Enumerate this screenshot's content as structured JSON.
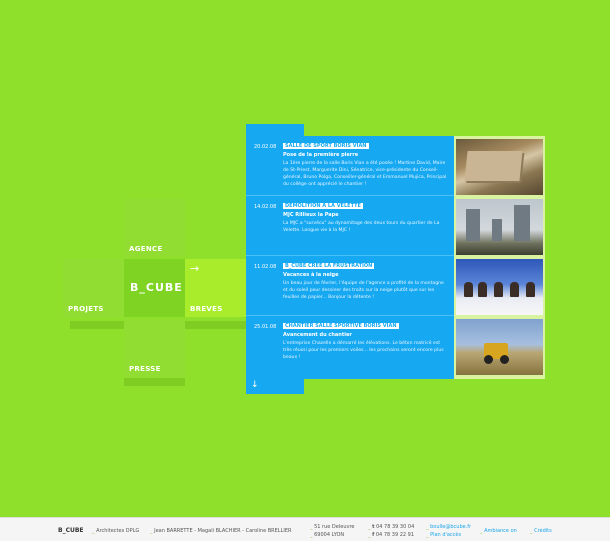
{
  "cube": {
    "brand": "B_CUBE",
    "agence": "AGENCE",
    "projets": "PROJETS",
    "breves": "BREVES",
    "presse": "PRESSE",
    "arrow": "→"
  },
  "news": [
    {
      "date": "20.02.08",
      "title": "SALLE DE SPORT BORIS VIAN",
      "subtitle": "Pose de la première pierre",
      "body": "La 1ère pierre de la salle Boris Vian a été posée ! Martine David, Maire de St-Priest, Marguerite Dini, Sénatrice, vice-présidente du Conseil-général, Bruno Polga, Conseiller-général et Emmanuel Mujica, Principal du collège ont apprécié le chantier !"
    },
    {
      "date": "14.02.08",
      "title": "DEMOLITION A LA VELETTE",
      "subtitle": "MJC Rillieux la Pape",
      "body": "La MJC a \"survécu\" au dynamitage des deux tours du quartier de La Velette. Longue vie à la MJC !"
    },
    {
      "date": "11.02.08",
      "title": "B_CUBE CREE LA FRUSTRATION",
      "subtitle": "Vacances à la neige",
      "body": "Un beau jour de février, l'équipe de l'agence a profité de la montagne et du soleil pour dessiner des traits sur la neige plutôt que sur les feuilles de papier... Bonjour la détente !"
    },
    {
      "date": "25.01.08",
      "title": "CHANTIER SALLE SPORTIVE BORIS VIAN",
      "subtitle": "Avancement du chantier",
      "body": "L'entreprise Chazelle a démarré les élévations. Le béton matricé est très réussi pour les premiers voiles... les prochains seront encore plus beaux !"
    }
  ],
  "panel": {
    "down_arrow": "↓"
  },
  "footer": {
    "brand": "B_CUBE",
    "architects": "Architectes DPLG",
    "names": "Jean BARRETTE - Magali BLACHIER - Caroline BRELLIER",
    "street": "51 rue Deleuvre",
    "city": "69004 LYON",
    "tel": "04 78 39 30 04",
    "fax": "04 78 39 22 91",
    "tel_label": "t",
    "fax_label": "f",
    "email": "boulle@bcube.fr",
    "plan": "Plan d'accès",
    "ambiance": "Ambiance on",
    "credits": "Crédits",
    "separator": "_"
  },
  "colors": {
    "background": "#8ee02a",
    "panel": "#17a8f2",
    "footer": "#f5f5f5"
  }
}
